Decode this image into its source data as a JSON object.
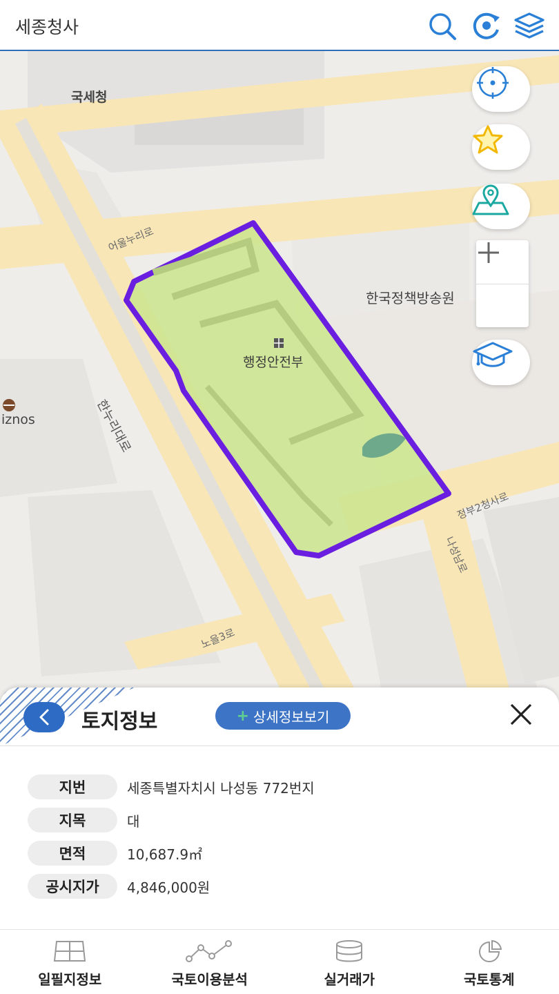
{
  "header": {
    "title": "세종청사"
  },
  "map": {
    "labels": {
      "national_tax_service": "국세청",
      "policy_broadcasting": "한국정책방송원",
      "ministry": "행정안전부",
      "partial_place": "iznos"
    },
    "roads": {
      "eoul_nuri": "어울누리로",
      "hannuri": "한누리대로",
      "jeongbu2": "정부2청사로",
      "naseongnam": "나성남로",
      "noeul3": "노을3로"
    },
    "colors": {
      "parcel_outline": "#6a1fe0",
      "parcel_fill": "#cde592",
      "road": "#f8e6b6"
    }
  },
  "panel": {
    "title": "토지정보",
    "detail_button": "상세정보보기",
    "rows": [
      {
        "label": "지번",
        "value": "세종특별자치시 나성동 772번지"
      },
      {
        "label": "지목",
        "value": "대"
      },
      {
        "label": "면적",
        "value": "10,687.9㎡"
      },
      {
        "label": "공시지가",
        "value": "4,846,000원"
      }
    ]
  },
  "nav": {
    "items": [
      {
        "label": "일필지정보",
        "icon": "grid-icon"
      },
      {
        "label": "국토이용분석",
        "icon": "line-graph-icon"
      },
      {
        "label": "실거래가",
        "icon": "database-icon"
      },
      {
        "label": "국토통계",
        "icon": "pie-chart-icon"
      }
    ]
  }
}
